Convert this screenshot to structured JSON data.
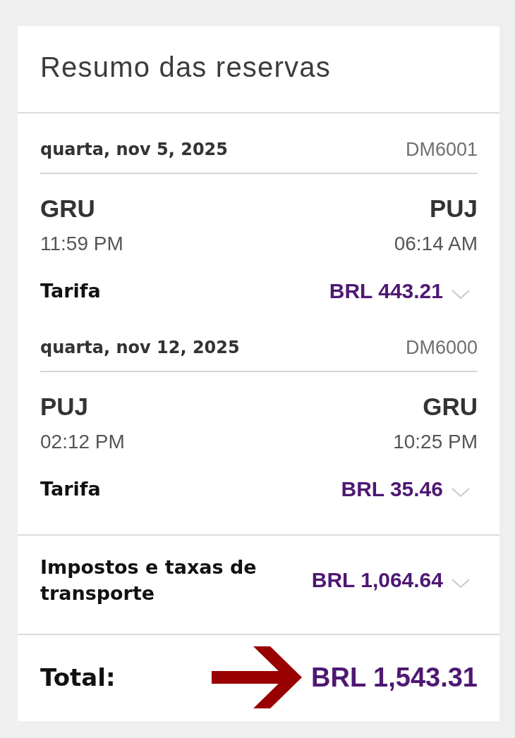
{
  "summary": {
    "title": "Resumo das reservas"
  },
  "flights": [
    {
      "date": "quarta, nov 5, 2025",
      "flight_number": "DM6001",
      "origin": {
        "code": "GRU",
        "time": "11:59 PM"
      },
      "destination": {
        "code": "PUJ",
        "time": "06:14 AM"
      },
      "fare": {
        "label": "Tarifa",
        "amount": "BRL 443.21",
        "expanded": false
      }
    },
    {
      "date": "quarta, nov 12, 2025",
      "flight_number": "DM6000",
      "origin": {
        "code": "PUJ",
        "time": "02:12 PM"
      },
      "destination": {
        "code": "GRU",
        "time": "10:25 PM"
      },
      "fare": {
        "label": "Tarifa",
        "amount": "BRL 35.46",
        "expanded": false
      }
    }
  ],
  "taxes": {
    "label": "Impostos e taxas de transporte",
    "amount": "BRL 1,064.64",
    "expanded": false
  },
  "total": {
    "label": "Total:",
    "amount": "BRL 1,543.31",
    "arrow_annotation": true
  }
}
